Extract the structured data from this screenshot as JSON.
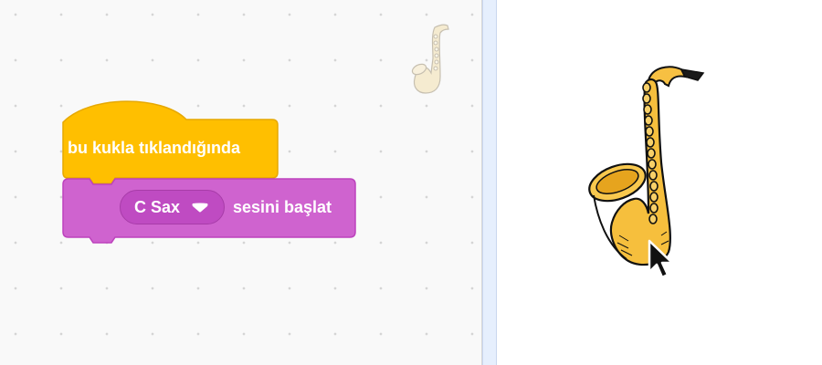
{
  "workspace": {
    "sprite_thumbnail_icon": "saxophone-icon"
  },
  "script": {
    "hat_block": {
      "label": "bu kukla tıklandığında",
      "color": "#ffbf00"
    },
    "sound_block": {
      "menu_value": "C Sax",
      "label": "sesini başlat",
      "color": "#cf63cf"
    }
  },
  "stage": {
    "sprite_icon": "saxophone-icon",
    "cursor_icon": "mouse-pointer-icon"
  }
}
